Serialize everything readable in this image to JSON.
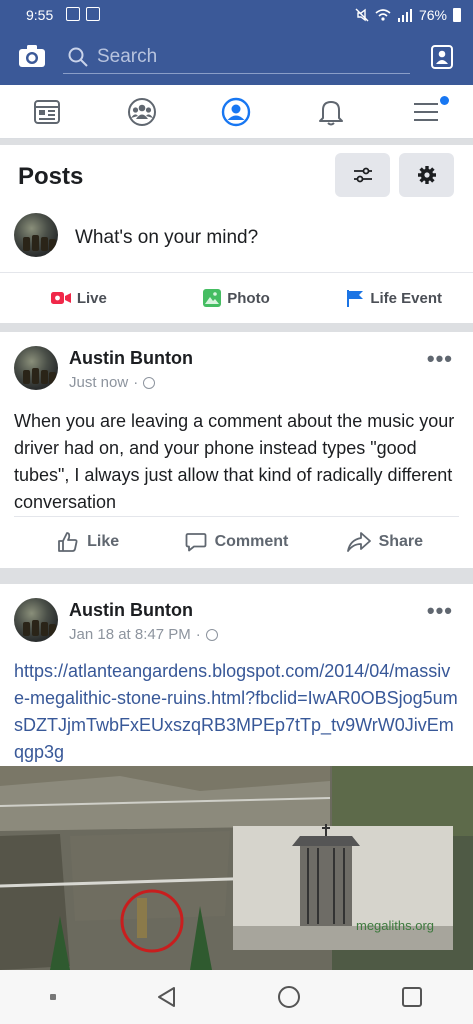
{
  "status_bar": {
    "time": "9:55",
    "battery": "76%"
  },
  "top_bar": {
    "search_placeholder": "Search"
  },
  "nav_tabs": [
    {
      "icon": "news-feed-icon"
    },
    {
      "icon": "groups-icon"
    },
    {
      "icon": "profile-icon",
      "active": true
    },
    {
      "icon": "notifications-bell-icon"
    },
    {
      "icon": "menu-icon",
      "badge": true
    }
  ],
  "posts_section": {
    "title": "Posts",
    "composer_prompt": "What's on your mind?",
    "actions": [
      {
        "label": "Live",
        "icon": "live-video-icon",
        "color": "#f02849"
      },
      {
        "label": "Photo",
        "icon": "photo-icon",
        "color": "#45bd62"
      },
      {
        "label": "Life Event",
        "icon": "flag-icon",
        "color": "#1b74e4"
      }
    ]
  },
  "posts": [
    {
      "author": "Austin Bunton",
      "time": "Just now",
      "privacy_icon": "globe-icon",
      "text": "When you are leaving a comment about the music your driver had on, and your phone instead types \"good tubes\", I always just allow that kind of radically different conversation"
    },
    {
      "author": "Austin Bunton",
      "time": "Jan 18 at 8:47 PM",
      "privacy_icon": "globe-icon",
      "link": "https://atlanteangardens.blogspot.com/2014/04/massive-megalithic-stone-ruins.html?fbclid=IwAR0OBSjog5umsDZTJjmTwbFxEUxszqRB3MPEp7tTp_tv9WrW0JivEmqgp3g",
      "watermark": "megaliths.org"
    }
  ],
  "post_actions": {
    "like": "Like",
    "comment": "Comment",
    "share": "Share"
  },
  "colors": {
    "brand_blue": "#3b5998",
    "active_blue": "#1877f2",
    "link_blue": "#385898"
  }
}
